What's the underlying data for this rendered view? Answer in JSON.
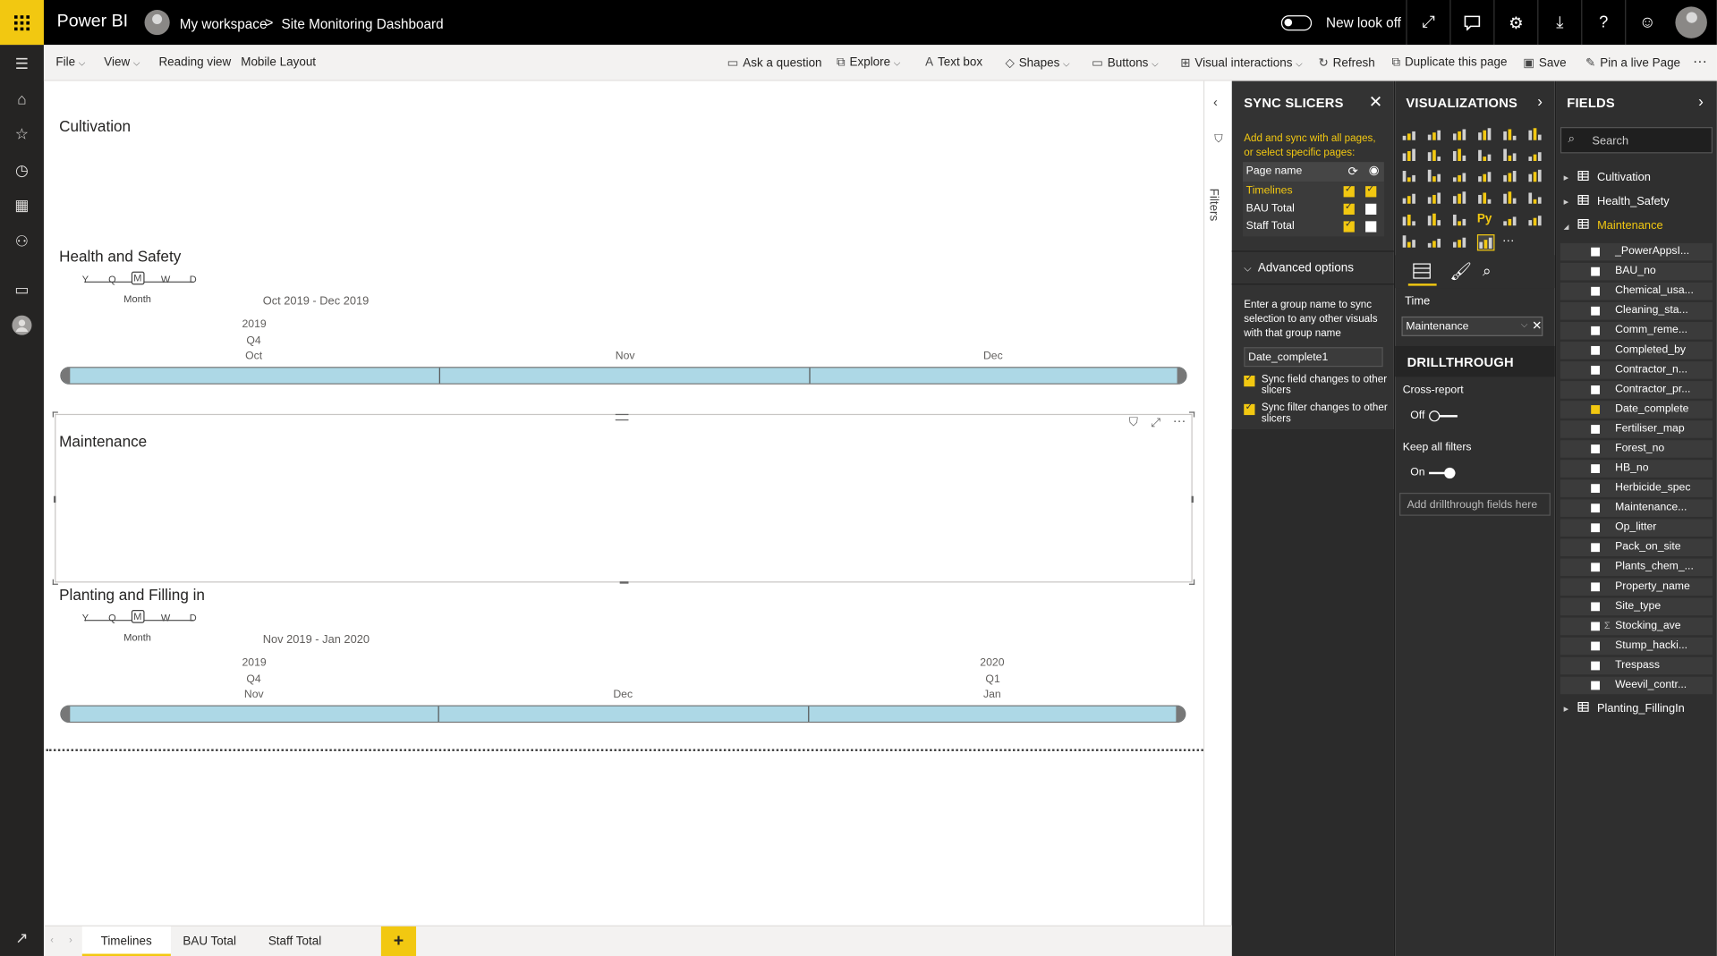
{
  "topbar": {
    "brand": "Power BI",
    "workspace": "My workspace",
    "separator": ">",
    "report": "Site Monitoring Dashboard",
    "new_look": "New look off"
  },
  "toolbar": {
    "file": "File",
    "view": "View",
    "reading_view": "Reading view",
    "mobile_layout": "Mobile Layout",
    "ask_question": "Ask a question",
    "explore": "Explore",
    "text_box": "Text box",
    "shapes": "Shapes",
    "buttons": "Buttons",
    "visual_interactions": "Visual interactions",
    "refresh": "Refresh",
    "duplicate": "Duplicate this page",
    "save": "Save",
    "pin": "Pin a live Page",
    "more": "···"
  },
  "canvas": {
    "cultivation": {
      "title": "Cultivation"
    },
    "health_safety": {
      "title": "Health and Safety",
      "units": [
        "Y",
        "Q",
        "M",
        "W",
        "D"
      ],
      "unit_selected": "Month",
      "range": "Oct 2019 - Dec 2019",
      "year": "2019",
      "quarter": "Q4",
      "months": [
        "Oct",
        "Nov",
        "Dec"
      ]
    },
    "maintenance": {
      "title": "Maintenance"
    },
    "planting": {
      "title": "Planting and Filling in",
      "units": [
        "Y",
        "Q",
        "M",
        "W",
        "D"
      ],
      "unit_selected": "Month",
      "range": "Nov 2019 - Jan 2020",
      "year1": "2019",
      "quarter1": "Q4",
      "year2": "2020",
      "quarter2": "Q1",
      "months": [
        "Nov",
        "Dec",
        "Jan"
      ]
    }
  },
  "filters_label": "Filters",
  "sync_slicers": {
    "title": "SYNC SLICERS",
    "intro": "Add and sync with all pages, or select specific pages:",
    "page_name_header": "Page name",
    "pages": [
      {
        "name": "Timelines",
        "sync": true,
        "visible": true
      },
      {
        "name": "BAU Total",
        "sync": true,
        "visible": false
      },
      {
        "name": "Staff Total",
        "sync": true,
        "visible": false
      }
    ],
    "advanced": "Advanced options",
    "group_help": "Enter a group name to sync selection to any other visuals with that group name",
    "group_value": "Date_complete1",
    "sync_field": "Sync field changes to other slicers",
    "sync_filter": "Sync filter changes to other slicers"
  },
  "visualizations": {
    "title": "VISUALIZATIONS",
    "time_label": "Time",
    "time_value": "Maintenance",
    "drillthrough": "DRILLTHROUGH",
    "cross_report": "Cross-report",
    "cross_report_state": "Off",
    "keep_filters": "Keep all filters",
    "keep_filters_state": "On",
    "add_fields": "Add drillthrough fields here",
    "py": "Py",
    "more": "···"
  },
  "fields": {
    "title": "FIELDS",
    "search_placeholder": "Search",
    "tables": [
      "Cultivation",
      "Health_Safety",
      "Maintenance"
    ],
    "maintenance_fields": [
      {
        "name": "_PowerAppsI...",
        "checked": false
      },
      {
        "name": "BAU_no",
        "checked": false
      },
      {
        "name": "Chemical_usa...",
        "checked": false
      },
      {
        "name": "Cleaning_sta...",
        "checked": false
      },
      {
        "name": "Comm_reme...",
        "checked": false
      },
      {
        "name": "Completed_by",
        "checked": false
      },
      {
        "name": "Contractor_n...",
        "checked": false
      },
      {
        "name": "Contractor_pr...",
        "checked": false
      },
      {
        "name": "Date_complete",
        "checked": true
      },
      {
        "name": "Fertiliser_map",
        "checked": false
      },
      {
        "name": "Forest_no",
        "checked": false
      },
      {
        "name": "HB_no",
        "checked": false
      },
      {
        "name": "Herbicide_spec",
        "checked": false
      },
      {
        "name": "Maintenance...",
        "checked": false
      },
      {
        "name": "Op_litter",
        "checked": false
      },
      {
        "name": "Pack_on_site",
        "checked": false
      },
      {
        "name": "Plants_chem_...",
        "checked": false
      },
      {
        "name": "Property_name",
        "checked": false
      },
      {
        "name": "Site_type",
        "checked": false
      },
      {
        "name": "Stocking_ave",
        "checked": false,
        "sigma": "Σ"
      },
      {
        "name": "Stump_hacki...",
        "checked": false
      },
      {
        "name": "Trespass",
        "checked": false
      },
      {
        "name": "Weevil_contr...",
        "checked": false
      }
    ],
    "last_table": "Planting_FillingIn"
  },
  "tabs": [
    "Timelines",
    "BAU Total",
    "Staff Total"
  ],
  "add_tab": "+",
  "colors": {
    "accent": "#f2c811",
    "timeline": "#add8e6",
    "pane": "#2f2f2f"
  }
}
